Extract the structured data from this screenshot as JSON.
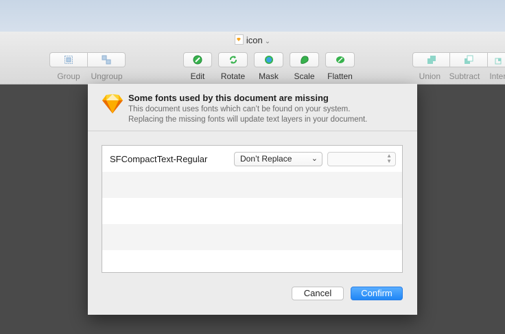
{
  "window": {
    "document_title": "icon"
  },
  "toolbar": {
    "group_label": "Group",
    "ungroup_label": "Ungroup",
    "edit_label": "Edit",
    "rotate_label": "Rotate",
    "mask_label": "Mask",
    "scale_label": "Scale",
    "flatten_label": "Flatten",
    "union_label": "Union",
    "subtract_label": "Subtract",
    "intersect_label": "Inter"
  },
  "dialog": {
    "title": "Some fonts used by this document are missing",
    "message_line1": "This document uses fonts which can’t be found on your system.",
    "message_line2": "Replacing the missing fonts will update text layers in your document.",
    "rows": [
      {
        "font": "SFCompactText-Regular",
        "replacement": "Don’t Replace",
        "variant": ""
      }
    ],
    "cancel_label": "Cancel",
    "confirm_label": "Confirm"
  },
  "colors": {
    "accent": "#1f86f5",
    "icon_green": "#37b24d",
    "icon_teal": "#5cc8b8",
    "sketch_orange": "#f6a623"
  }
}
